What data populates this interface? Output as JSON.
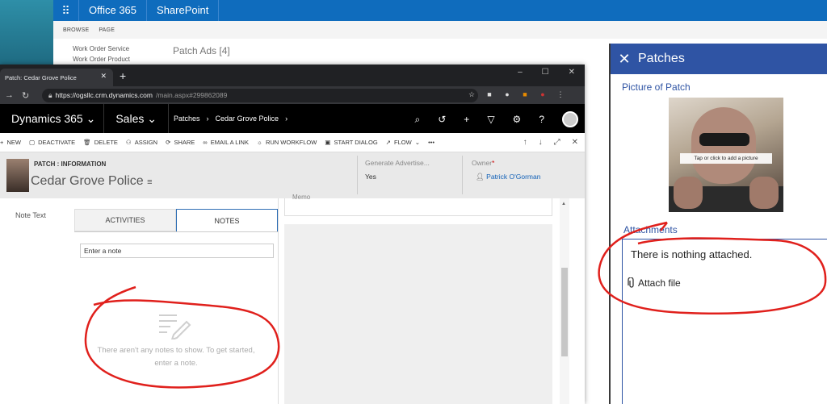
{
  "o365": {
    "app_launcher": "⠿",
    "office": "Office 365",
    "site": "SharePoint"
  },
  "ribbon": {
    "browse": "BROWSE",
    "page": "PAGE"
  },
  "sp_nav": {
    "items": [
      "Work Order Service",
      "Work Order Product"
    ]
  },
  "sp_title": "Patch Ads [4]",
  "browser": {
    "tab_title": "Patch: Cedar Grove Police",
    "url_host": "https://ogsllc.crm.dynamics.com",
    "url_path": "/main.aspx#299862089"
  },
  "dynamics": {
    "app": "Dynamics 365",
    "area": "Sales",
    "crumbs": [
      "Patches",
      "Cedar Grove Police"
    ]
  },
  "commands": [
    "NEW",
    "DEACTIVATE",
    "DELETE",
    "ASSIGN",
    "SHARE",
    "EMAIL A LINK",
    "RUN WORKFLOW",
    "START DIALOG",
    "FLOW",
    "•••"
  ],
  "record": {
    "type": "PATCH : INFORMATION",
    "name": "Cedar Grove Police",
    "gen_label": "Generate Advertise...",
    "gen_value": "Yes",
    "owner_label": "Owner",
    "owner_value": "Patrick O'Gorman"
  },
  "form": {
    "note_text_label": "Note Text",
    "tab_activities": "ACTIVITIES",
    "tab_notes": "NOTES",
    "note_placeholder": "Enter a note",
    "empty_line1": "There aren't any notes to show. To get started,",
    "empty_line2": "enter a note.",
    "memo_label": "Memo"
  },
  "patches_panel": {
    "title": "Patches",
    "picture_label": "Picture of Patch",
    "tap_hint": "Tap or click to add a picture",
    "attachments_label": "Attachments",
    "nothing_attached": "There is nothing attached.",
    "attach_file": "Attach file"
  },
  "colors": {
    "o365_blue": "#0f6cbd",
    "panel_blue": "#2f54a4",
    "annotation_red": "#e0201c"
  }
}
